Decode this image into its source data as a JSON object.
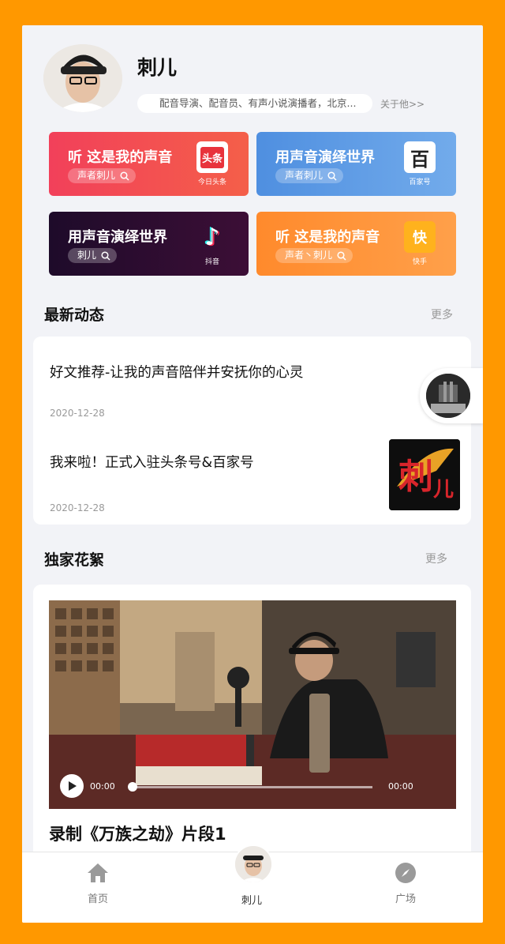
{
  "profile": {
    "name": "刺儿",
    "bio": "配音导演、配音员、有声小说演播者，北京...",
    "about_link": "关于他>>"
  },
  "cards": [
    {
      "title": "听 这是我的声音",
      "tag": "声者刺儿",
      "brand": "头条",
      "brand_caption": "今日头条",
      "color": "#F34A57"
    },
    {
      "title": "用声音演绎世界",
      "tag": "声者刺儿",
      "brand": "百",
      "brand_caption": "百家号",
      "color": "#5B9BE3"
    },
    {
      "title": "用声音演绎世界",
      "tag": "刺儿",
      "brand": "♪",
      "brand_caption": "抖音",
      "color": "#2B1133"
    },
    {
      "title": "听 这是我的声音",
      "tag": "声者丶刺儿",
      "brand": "快",
      "brand_caption": "快手",
      "color": "#FF8D2E"
    }
  ],
  "news": {
    "title": "最新动态",
    "more": "更多",
    "items": [
      {
        "title": "好文推荐-让我的声音陪伴并安抚你的心灵",
        "date": "2020-12-28"
      },
      {
        "title": "我来啦！正式入驻头条号&百家号",
        "date": "2020-12-28"
      }
    ]
  },
  "clips": {
    "title": "独家花絮",
    "more": "更多",
    "video": {
      "current_time": "00:00",
      "duration": "00:00",
      "progress": 0,
      "caption": "录制《万族之劫》片段1"
    }
  },
  "tabs": [
    {
      "label": "首页",
      "icon": "home-icon"
    },
    {
      "label": "刺儿",
      "icon": "avatar"
    },
    {
      "label": "广场",
      "icon": "compass-icon"
    }
  ],
  "colors": {
    "frame": "#FF9800",
    "background": "#F2F3F7"
  }
}
